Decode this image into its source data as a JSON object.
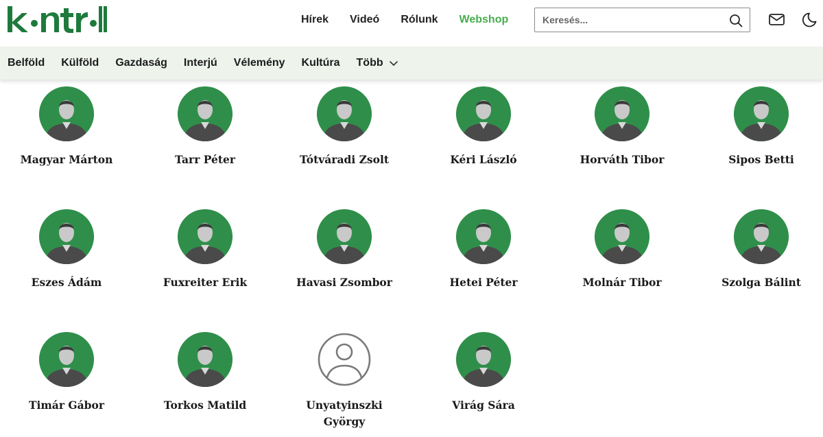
{
  "header": {
    "logo_text": "kontroll",
    "nav": [
      {
        "label": "Hírek"
      },
      {
        "label": "Videó"
      },
      {
        "label": "Rólunk"
      },
      {
        "label": "Webshop"
      }
    ],
    "search_placeholder": "Keresés...",
    "icons": [
      "search-icon",
      "mail-icon",
      "moon-icon"
    ],
    "accent_color": "#47ad4f",
    "brand_color": "#1e7a3c"
  },
  "categories": [
    {
      "label": "Belföld"
    },
    {
      "label": "Külföld"
    },
    {
      "label": "Gazdaság"
    },
    {
      "label": "Interjú"
    },
    {
      "label": "Vélemény"
    },
    {
      "label": "Kultúra"
    },
    {
      "label": "Több"
    }
  ],
  "authors": [
    {
      "name": "Magyar Márton",
      "photo": true
    },
    {
      "name": "Tarr Péter",
      "photo": true
    },
    {
      "name": "Tótváradi Zsolt",
      "photo": true
    },
    {
      "name": "Kéri László",
      "photo": true
    },
    {
      "name": "Horváth Tibor",
      "photo": true
    },
    {
      "name": "Sipos Betti",
      "photo": true
    },
    {
      "name": "Eszes Ádám",
      "photo": true
    },
    {
      "name": "Fuxreiter Erik",
      "photo": true
    },
    {
      "name": "Havasi Zsombor",
      "photo": true
    },
    {
      "name": "Hetei Péter",
      "photo": true
    },
    {
      "name": "Molnár Tibor",
      "photo": true
    },
    {
      "name": "Szolga Bálint",
      "photo": true
    },
    {
      "name": "Timár Gábor",
      "photo": true
    },
    {
      "name": "Torkos Matild",
      "photo": true
    },
    {
      "name": "Unyatyinszki György",
      "photo": false
    },
    {
      "name": "Virág Sára",
      "photo": true
    }
  ]
}
